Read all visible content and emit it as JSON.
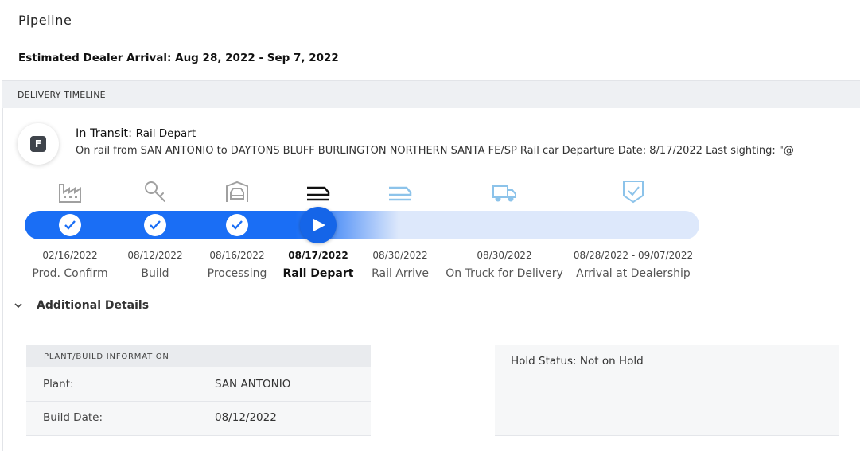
{
  "page": {
    "title": "Pipeline",
    "estimated_arrival": "Estimated Dealer Arrival: Aug 28, 2022 - Sep 7, 2022"
  },
  "timeline": {
    "header": "DELIVERY TIMELINE",
    "badge_letter": "F",
    "status_prefix": "In Transit:",
    "status_stage": "Rail Depart",
    "status_description": "On rail from SAN ANTONIO to DAYTONS BLUFF BURLINGTON NORTHERN SANTA FE/SP Rail car Departure Date: 8/17/2022 Last sighting: \"@",
    "steps": [
      {
        "date": "02/16/2022",
        "label": "Prod. Confirm",
        "icon": "factory-icon",
        "state": "complete"
      },
      {
        "date": "08/12/2022",
        "label": "Build",
        "icon": "wrench-icon",
        "state": "complete"
      },
      {
        "date": "08/16/2022",
        "label": "Processing",
        "icon": "car-wash-icon",
        "state": "complete"
      },
      {
        "date": "08/17/2022",
        "label": "Rail Depart",
        "icon": "rail-icon",
        "state": "current"
      },
      {
        "date": "08/30/2022",
        "label": "Rail Arrive",
        "icon": "rail-icon",
        "state": "upcoming"
      },
      {
        "date": "08/30/2022",
        "label": "On Truck for Delivery",
        "icon": "truck-icon",
        "state": "upcoming"
      },
      {
        "date": "08/28/2022 - 09/07/2022",
        "label": "Arrival at Dealership",
        "icon": "shield-check-icon",
        "state": "upcoming"
      }
    ],
    "colors": {
      "progress": "#1a6ef5",
      "track": "#dde8fb",
      "upcoming_icon": "#8cc3ea",
      "complete_icon": "#9a9a9a"
    }
  },
  "details": {
    "toggle_label": "Additional Details",
    "plant_card": {
      "title": "PLANT/BUILD INFORMATION",
      "rows": [
        {
          "label": "Plant:",
          "value": "SAN ANTONIO"
        },
        {
          "label": "Build Date:",
          "value": "08/12/2022"
        }
      ]
    },
    "hold_status": "Hold Status: Not on Hold"
  }
}
